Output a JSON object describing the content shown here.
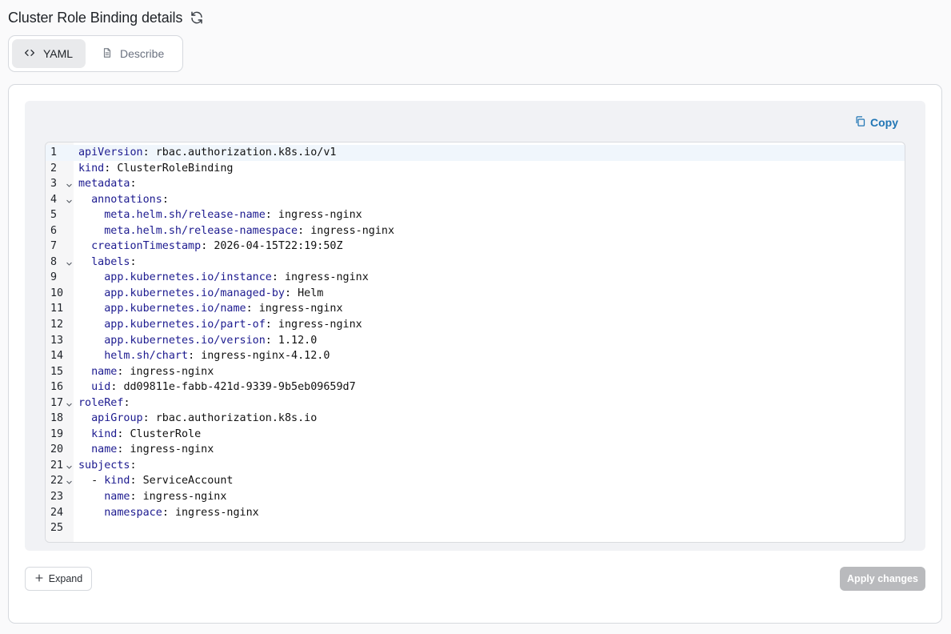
{
  "page": {
    "title": "Cluster Role Binding details"
  },
  "tabs": [
    {
      "label": "YAML",
      "icon": "code-icon",
      "active": true
    },
    {
      "label": "Describe",
      "icon": "document-icon",
      "active": false
    }
  ],
  "editor": {
    "copy_label": "Copy",
    "active_line": 1,
    "lines": [
      {
        "n": "1",
        "fold": false,
        "indent": "",
        "key": "apiVersion",
        "sep": ": ",
        "value": "rbac.authorization.k8s.io/v1"
      },
      {
        "n": "2",
        "fold": false,
        "indent": "",
        "key": "kind",
        "sep": ": ",
        "value": "ClusterRoleBinding"
      },
      {
        "n": "3",
        "fold": true,
        "indent": "",
        "key": "metadata",
        "sep": ":",
        "value": ""
      },
      {
        "n": "4",
        "fold": true,
        "indent": "  ",
        "key": "annotations",
        "sep": ":",
        "value": ""
      },
      {
        "n": "5",
        "fold": false,
        "indent": "    ",
        "key": "meta.helm.sh/release-name",
        "sep": ": ",
        "value": "ingress-nginx"
      },
      {
        "n": "6",
        "fold": false,
        "indent": "    ",
        "key": "meta.helm.sh/release-namespace",
        "sep": ": ",
        "value": "ingress-nginx"
      },
      {
        "n": "7",
        "fold": false,
        "indent": "  ",
        "key": "creationTimestamp",
        "sep": ": ",
        "value": "2026-04-15T22:19:50Z"
      },
      {
        "n": "8",
        "fold": true,
        "indent": "  ",
        "key": "labels",
        "sep": ":",
        "value": ""
      },
      {
        "n": "9",
        "fold": false,
        "indent": "    ",
        "key": "app.kubernetes.io/instance",
        "sep": ": ",
        "value": "ingress-nginx"
      },
      {
        "n": "10",
        "fold": false,
        "indent": "    ",
        "key": "app.kubernetes.io/managed-by",
        "sep": ": ",
        "value": "Helm"
      },
      {
        "n": "11",
        "fold": false,
        "indent": "    ",
        "key": "app.kubernetes.io/name",
        "sep": ": ",
        "value": "ingress-nginx"
      },
      {
        "n": "12",
        "fold": false,
        "indent": "    ",
        "key": "app.kubernetes.io/part-of",
        "sep": ": ",
        "value": "ingress-nginx"
      },
      {
        "n": "13",
        "fold": false,
        "indent": "    ",
        "key": "app.kubernetes.io/version",
        "sep": ": ",
        "value": "1.12.0"
      },
      {
        "n": "14",
        "fold": false,
        "indent": "    ",
        "key": "helm.sh/chart",
        "sep": ": ",
        "value": "ingress-nginx-4.12.0"
      },
      {
        "n": "15",
        "fold": false,
        "indent": "  ",
        "key": "name",
        "sep": ": ",
        "value": "ingress-nginx"
      },
      {
        "n": "16",
        "fold": false,
        "indent": "  ",
        "key": "uid",
        "sep": ": ",
        "value": "dd09811e-fabb-421d-9339-9b5eb09659d7"
      },
      {
        "n": "17",
        "fold": true,
        "indent": "",
        "key": "roleRef",
        "sep": ":",
        "value": ""
      },
      {
        "n": "18",
        "fold": false,
        "indent": "  ",
        "key": "apiGroup",
        "sep": ": ",
        "value": "rbac.authorization.k8s.io"
      },
      {
        "n": "19",
        "fold": false,
        "indent": "  ",
        "key": "kind",
        "sep": ": ",
        "value": "ClusterRole"
      },
      {
        "n": "20",
        "fold": false,
        "indent": "  ",
        "key": "name",
        "sep": ": ",
        "value": "ingress-nginx"
      },
      {
        "n": "21",
        "fold": true,
        "indent": "",
        "key": "subjects",
        "sep": ":",
        "value": ""
      },
      {
        "n": "22",
        "fold": true,
        "indent": "  - ",
        "key": "kind",
        "sep": ": ",
        "value": "ServiceAccount"
      },
      {
        "n": "23",
        "fold": false,
        "indent": "    ",
        "key": "name",
        "sep": ": ",
        "value": "ingress-nginx"
      },
      {
        "n": "24",
        "fold": false,
        "indent": "    ",
        "key": "namespace",
        "sep": ": ",
        "value": "ingress-nginx"
      },
      {
        "n": "25",
        "fold": false,
        "indent": "",
        "key": "",
        "sep": "",
        "value": ""
      }
    ]
  },
  "footer": {
    "expand_label": "Expand",
    "apply_label": "Apply changes"
  },
  "colors": {
    "accent": "#2176b5",
    "yaml_key": "#1c1a8f",
    "apply_disabled_bg": "#b9babd"
  }
}
